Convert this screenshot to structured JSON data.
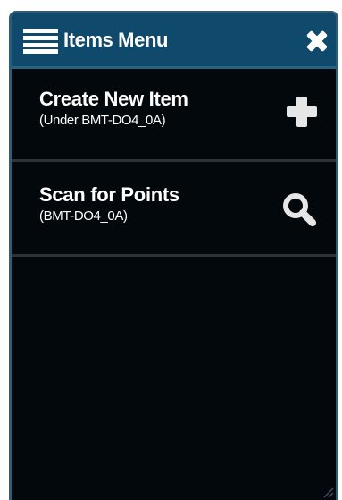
{
  "header": {
    "title": "Items Menu",
    "menu_icon": "hamburger-icon",
    "close_icon": "close-icon"
  },
  "items": [
    {
      "title": "Create New Item",
      "subtitle": "(Under BMT-DO4_0A)",
      "icon": "plus-icon"
    },
    {
      "title": "Scan for Points",
      "subtitle": "(BMT-DO4_0A)",
      "icon": "search-icon"
    }
  ],
  "colors": {
    "header_bg": "#0f4a6c",
    "panel_bg": "#03080d",
    "panel_border": "#2f5d78",
    "divider": "#2d3238",
    "text": "#ffffff"
  }
}
